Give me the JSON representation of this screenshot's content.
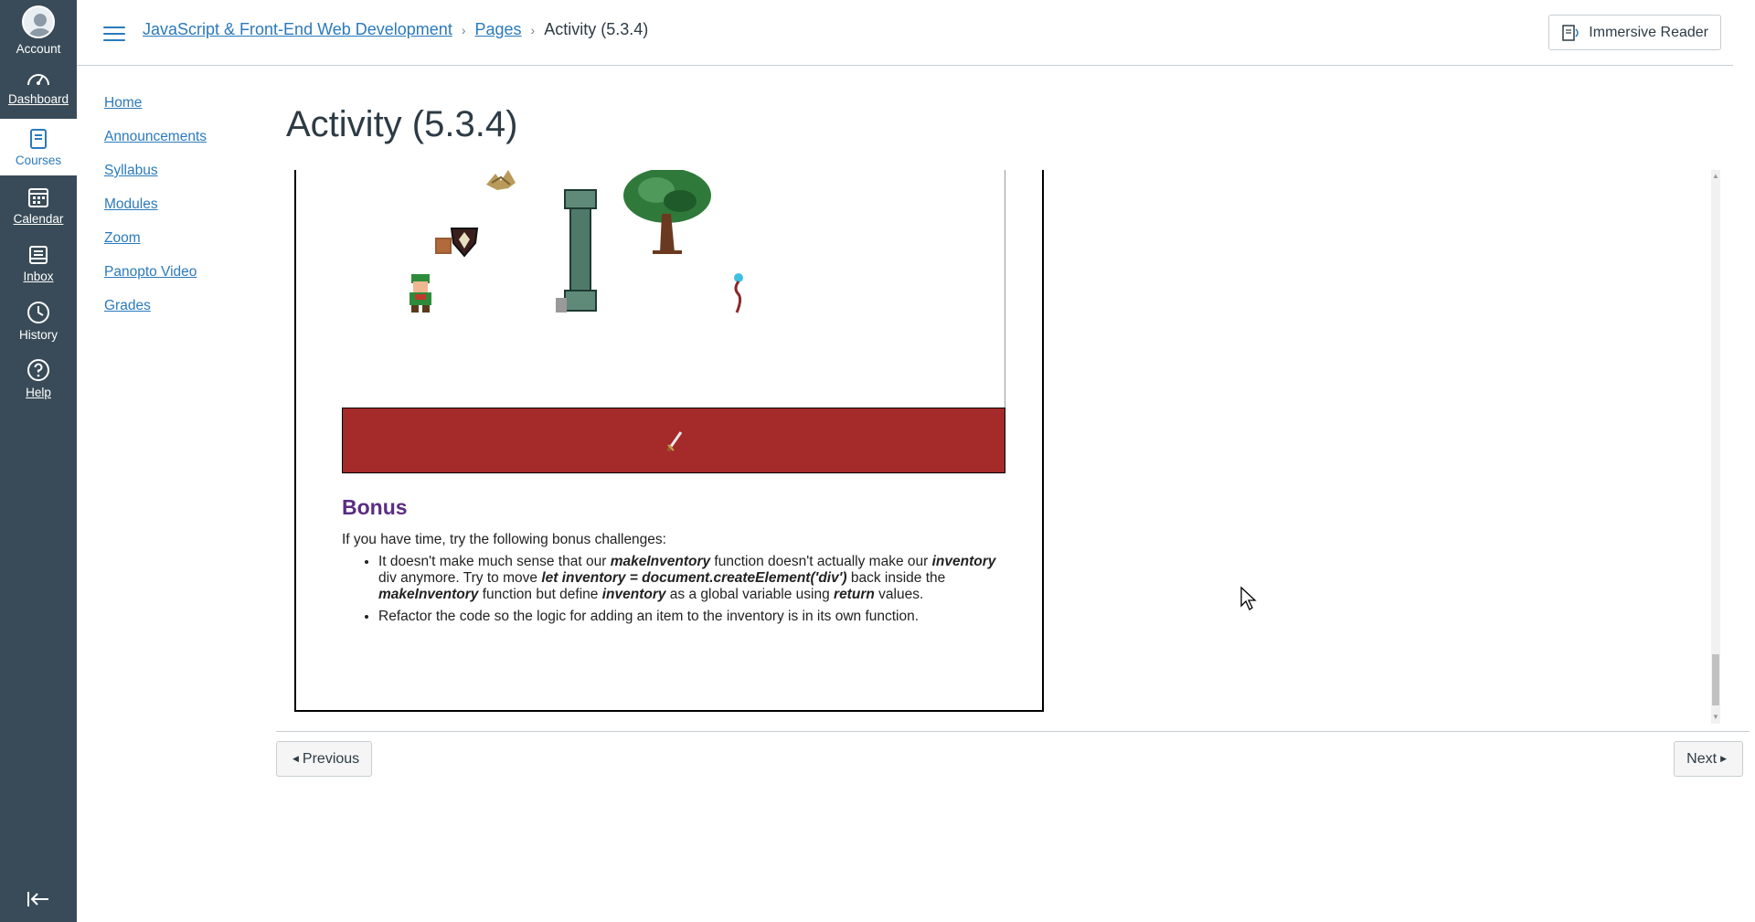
{
  "global_nav": {
    "account": "Account",
    "dashboard": "Dashboard",
    "courses": "Courses",
    "calendar": "Calendar",
    "inbox": "Inbox",
    "history": "History",
    "help": "Help"
  },
  "breadcrumb": {
    "course": "JavaScript & Front-End Web Development",
    "section": "Pages",
    "current": "Activity (5.3.4)"
  },
  "header": {
    "immersive_reader": "Immersive Reader"
  },
  "course_nav": [
    "Home",
    "Announcements",
    "Syllabus",
    "Modules",
    "Zoom",
    "Panopto Video",
    "Grades"
  ],
  "page_title": "Activity (5.3.4)",
  "document": {
    "bonus_heading": "Bonus",
    "intro": "If you have time, try the following bonus challenges:",
    "bullet1": {
      "t1": "It doesn't make much sense that our ",
      "b1": "makeInventory",
      "t2": " function doesn't actually make our ",
      "b2": "inventory",
      "t3": " div anymore. Try to move ",
      "b3": "let inventory = document.createElement('div')",
      "t4": " back inside the ",
      "b4": "makeInventory",
      "t5": " function but define ",
      "b5": "inventory",
      "t6": " as a global variable using ",
      "b6": "return",
      "t7": " values."
    },
    "bullet2": "Refactor the code so the logic for adding an item to the inventory is in its own function."
  },
  "footer": {
    "previous": "Previous",
    "next": "Next"
  },
  "colors": {
    "nav_bg": "#394b58",
    "link": "#2b7abc",
    "inventory_bar": "#a52a2a",
    "bonus_heading": "#5a2d82"
  }
}
